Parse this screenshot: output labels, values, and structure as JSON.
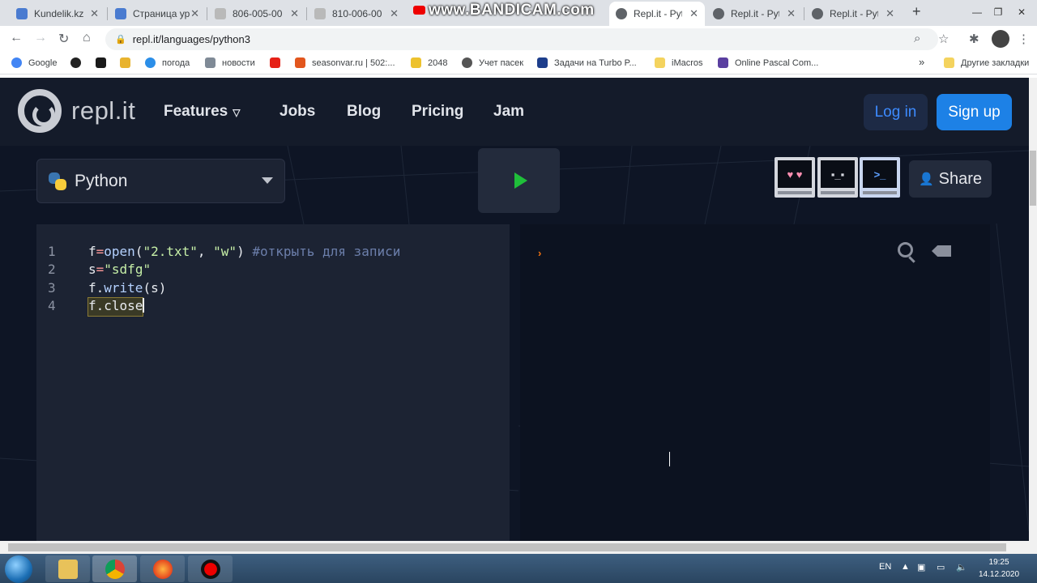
{
  "browser": {
    "tabs": [
      {
        "title": "Kundelik.kz",
        "active": false
      },
      {
        "title": "Страница ур",
        "active": false
      },
      {
        "title": "806-005-00",
        "active": false
      },
      {
        "title": "810-006-00",
        "active": false
      },
      {
        "title": "",
        "active": false
      },
      {
        "title": "Repl.it - Pyth",
        "active": true
      },
      {
        "title": "Repl.it - Pyth",
        "active": false
      },
      {
        "title": "Repl.it - Pyth",
        "active": false
      }
    ],
    "watermark": "www.BANDICAM.com",
    "url": "repl.it/languages/python3",
    "bookmarks": [
      "Google",
      "",
      "",
      "",
      "погода",
      "новости",
      "",
      "seasonvar.ru | 502:...",
      "2048",
      "Учет пасек",
      "Задачи на Turbo P...",
      "iMacros",
      "Online Pascal Com..."
    ],
    "other_bookmarks": "Другие закладки",
    "overflow": "»"
  },
  "site": {
    "logo_text": "repl.it",
    "nav": {
      "features": "Features",
      "jobs": "Jobs",
      "blog": "Blog",
      "pricing": "Pricing",
      "jam": "Jam"
    },
    "login": "Log in",
    "signup": "Sign up",
    "language": "Python",
    "share": "Share",
    "editor_lines": [
      {
        "n": "1"
      },
      {
        "n": "2"
      },
      {
        "n": "3"
      },
      {
        "n": "4"
      }
    ],
    "code": {
      "l1_f": "f",
      "l1_eq": "=",
      "l1_fn": "open",
      "l1_p1": "(",
      "l1_s1": "\"2.txt\"",
      "l1_c": ", ",
      "l1_s2": "\"w\"",
      "l1_p2": ") ",
      "l1_cmt": "#открыть для записи",
      "l2_s": "s",
      "l2_eq": "=",
      "l2_str": "\"sdfg\"",
      "l3_obj": "f.",
      "l3_fn": "write",
      "l3_args": "(s)",
      "l4_code": "f.close"
    },
    "console_prompt": "›"
  },
  "taskbar": {
    "lang": "EN",
    "time": "19:25",
    "date": "14.12.2020"
  },
  "colors": {
    "page_bg": "#0e1525",
    "accent_blue": "#1d81e6",
    "run_green": "#1fbf3a",
    "prompt_orange": "#f5730f"
  }
}
